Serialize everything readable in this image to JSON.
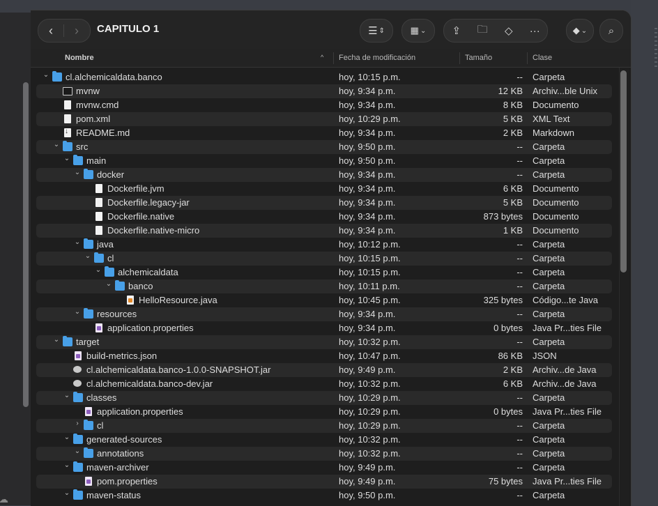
{
  "window": {
    "title": "CAPITULO 1"
  },
  "toolbar": {
    "back_icon": "chevron-left-icon",
    "forward_icon": "chevron-right-icon",
    "view_icon": "list-view-icon",
    "group_icon": "grid-group-icon",
    "share_icon": "share-icon",
    "new_folder_icon": "new-folder-icon",
    "tag_icon": "tag-icon",
    "more_icon": "ellipsis-icon",
    "dropbox_icon": "dropbox-icon",
    "search_icon": "search-icon"
  },
  "columns": {
    "name": "Nombre",
    "date": "Fecha de modificación",
    "size": "Tamaño",
    "kind": "Clase"
  },
  "rows": [
    {
      "name": "cl.alchemicaldata.banco",
      "date": "hoy, 10:15 p.m.",
      "size": "--",
      "kind": "Carpeta",
      "depth": 0,
      "type": "folder",
      "disc": "down"
    },
    {
      "name": "mvnw",
      "date": "hoy, 9:34 p.m.",
      "size": "12 KB",
      "kind": "Archiv...ble Unix",
      "depth": 1,
      "type": "exec",
      "disc": ""
    },
    {
      "name": "mvnw.cmd",
      "date": "hoy, 9:34 p.m.",
      "size": "8 KB",
      "kind": "Documento",
      "depth": 1,
      "type": "doc",
      "disc": ""
    },
    {
      "name": "pom.xml",
      "date": "hoy, 10:29 p.m.",
      "size": "5 KB",
      "kind": "XML Text",
      "depth": 1,
      "type": "doc",
      "disc": ""
    },
    {
      "name": "README.md",
      "date": "hoy, 9:34 p.m.",
      "size": "2 KB",
      "kind": "Markdown",
      "depth": 1,
      "type": "md",
      "disc": ""
    },
    {
      "name": "src",
      "date": "hoy, 9:50 p.m.",
      "size": "--",
      "kind": "Carpeta",
      "depth": 1,
      "type": "folder",
      "disc": "down"
    },
    {
      "name": "main",
      "date": "hoy, 9:50 p.m.",
      "size": "--",
      "kind": "Carpeta",
      "depth": 2,
      "type": "folder",
      "disc": "down"
    },
    {
      "name": "docker",
      "date": "hoy, 9:34 p.m.",
      "size": "--",
      "kind": "Carpeta",
      "depth": 3,
      "type": "folder",
      "disc": "down"
    },
    {
      "name": "Dockerfile.jvm",
      "date": "hoy, 9:34 p.m.",
      "size": "6 KB",
      "kind": "Documento",
      "depth": 4,
      "type": "doc",
      "disc": ""
    },
    {
      "name": "Dockerfile.legacy-jar",
      "date": "hoy, 9:34 p.m.",
      "size": "5 KB",
      "kind": "Documento",
      "depth": 4,
      "type": "doc",
      "disc": ""
    },
    {
      "name": "Dockerfile.native",
      "date": "hoy, 9:34 p.m.",
      "size": "873 bytes",
      "kind": "Documento",
      "depth": 4,
      "type": "doc",
      "disc": ""
    },
    {
      "name": "Dockerfile.native-micro",
      "date": "hoy, 9:34 p.m.",
      "size": "1 KB",
      "kind": "Documento",
      "depth": 4,
      "type": "doc",
      "disc": ""
    },
    {
      "name": "java",
      "date": "hoy, 10:12 p.m.",
      "size": "--",
      "kind": "Carpeta",
      "depth": 3,
      "type": "folder",
      "disc": "down"
    },
    {
      "name": "cl",
      "date": "hoy, 10:15 p.m.",
      "size": "--",
      "kind": "Carpeta",
      "depth": 4,
      "type": "folder",
      "disc": "down"
    },
    {
      "name": "alchemicaldata",
      "date": "hoy, 10:15 p.m.",
      "size": "--",
      "kind": "Carpeta",
      "depth": 5,
      "type": "folder",
      "disc": "down"
    },
    {
      "name": "banco",
      "date": "hoy, 10:11 p.m.",
      "size": "--",
      "kind": "Carpeta",
      "depth": 6,
      "type": "folder",
      "disc": "down"
    },
    {
      "name": "HelloResource.java",
      "date": "hoy, 10:45 p.m.",
      "size": "325 bytes",
      "kind": "Código...te Java",
      "depth": 7,
      "type": "java",
      "disc": ""
    },
    {
      "name": "resources",
      "date": "hoy, 9:34 p.m.",
      "size": "--",
      "kind": "Carpeta",
      "depth": 3,
      "type": "folder",
      "disc": "down"
    },
    {
      "name": "application.properties",
      "date": "hoy, 9:34 p.m.",
      "size": "0 bytes",
      "kind": "Java Pr...ties File",
      "depth": 4,
      "type": "props",
      "disc": ""
    },
    {
      "name": "target",
      "date": "hoy, 10:32 p.m.",
      "size": "--",
      "kind": "Carpeta",
      "depth": 1,
      "type": "folder",
      "disc": "down"
    },
    {
      "name": "build-metrics.json",
      "date": "hoy, 10:47 p.m.",
      "size": "86 KB",
      "kind": "JSON",
      "depth": 2,
      "type": "props",
      "disc": ""
    },
    {
      "name": "cl.alchemicaldata.banco-1.0.0-SNAPSHOT.jar",
      "date": "hoy, 9:49 p.m.",
      "size": "2 KB",
      "kind": "Archiv...de Java",
      "depth": 2,
      "type": "jar",
      "disc": ""
    },
    {
      "name": "cl.alchemicaldata.banco-dev.jar",
      "date": "hoy, 10:32 p.m.",
      "size": "6 KB",
      "kind": "Archiv...de Java",
      "depth": 2,
      "type": "jar",
      "disc": ""
    },
    {
      "name": "classes",
      "date": "hoy, 10:29 p.m.",
      "size": "--",
      "kind": "Carpeta",
      "depth": 2,
      "type": "folder",
      "disc": "down"
    },
    {
      "name": "application.properties",
      "date": "hoy, 10:29 p.m.",
      "size": "0 bytes",
      "kind": "Java Pr...ties File",
      "depth": 3,
      "type": "props",
      "disc": ""
    },
    {
      "name": "cl",
      "date": "hoy, 10:29 p.m.",
      "size": "--",
      "kind": "Carpeta",
      "depth": 3,
      "type": "folder",
      "disc": "right"
    },
    {
      "name": "generated-sources",
      "date": "hoy, 10:32 p.m.",
      "size": "--",
      "kind": "Carpeta",
      "depth": 2,
      "type": "folder",
      "disc": "down"
    },
    {
      "name": "annotations",
      "date": "hoy, 10:32 p.m.",
      "size": "--",
      "kind": "Carpeta",
      "depth": 3,
      "type": "folder",
      "disc": "down"
    },
    {
      "name": "maven-archiver",
      "date": "hoy, 9:49 p.m.",
      "size": "--",
      "kind": "Carpeta",
      "depth": 2,
      "type": "folder",
      "disc": "down"
    },
    {
      "name": "pom.properties",
      "date": "hoy, 9:49 p.m.",
      "size": "75 bytes",
      "kind": "Java Pr...ties File",
      "depth": 3,
      "type": "props",
      "disc": ""
    },
    {
      "name": "maven-status",
      "date": "hoy, 9:50 p.m.",
      "size": "--",
      "kind": "Carpeta",
      "depth": 2,
      "type": "folder",
      "disc": "down"
    }
  ]
}
